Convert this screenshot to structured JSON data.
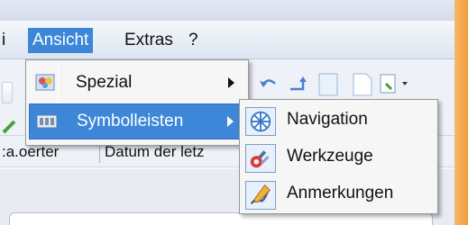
{
  "menubar": {
    "items": [
      "i",
      "Ansicht",
      "Extras",
      "?"
    ]
  },
  "addressbar": {
    "user": ":a.oerter",
    "column": "Datum der letz"
  },
  "ansicht_menu": {
    "items": [
      {
        "label": "Spezial",
        "icon": "special-view-icon",
        "has_submenu": true
      },
      {
        "label": "Symbolleisten",
        "icon": "toolbars-icon",
        "has_submenu": true,
        "highlighted": true
      }
    ]
  },
  "symbolleisten_menu": {
    "items": [
      {
        "label": "Navigation",
        "icon": "navigation-icon",
        "checked": true
      },
      {
        "label": "Werkzeuge",
        "icon": "tools-icon",
        "checked": true
      },
      {
        "label": "Anmerkungen",
        "icon": "annotations-icon",
        "checked": true
      }
    ]
  },
  "colors": {
    "highlight": "#3d86d8",
    "window_frame": "#f19b3d"
  }
}
